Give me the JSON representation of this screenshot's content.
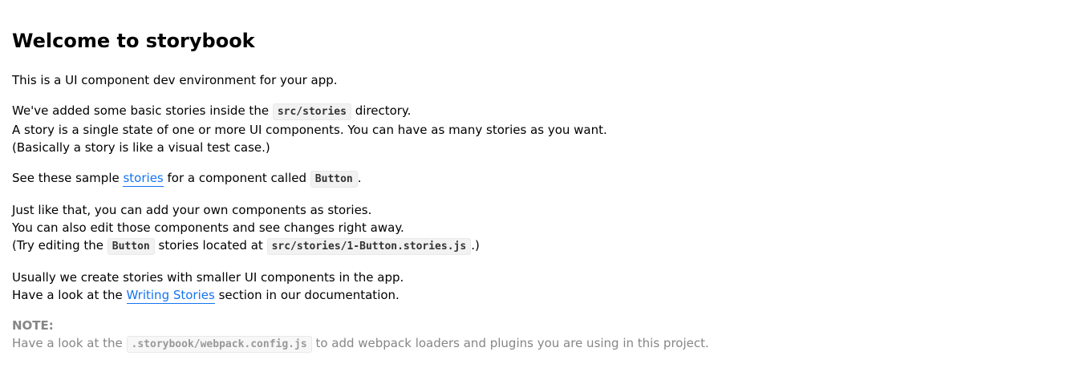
{
  "title": "Welcome to storybook",
  "p1": "This is a UI component dev environment for your app.",
  "p2": {
    "l1a": "We've added some basic stories inside the ",
    "l1code": "src/stories",
    "l1b": " directory.",
    "l2": "A story is a single state of one or more UI components. You can have as many stories as you want.",
    "l3": "(Basically a story is like a visual test case.)"
  },
  "p3": {
    "a": "See these sample ",
    "link": "stories",
    "b": " for a component called ",
    "code": "Button",
    "c": "."
  },
  "p4": {
    "l1": "Just like that, you can add your own components as stories.",
    "l2": "You can also edit those components and see changes right away.",
    "l3a": "(Try editing the ",
    "l3code1": "Button",
    "l3b": " stories located at ",
    "l3code2": "src/stories/1-Button.stories.js",
    "l3c": ".)"
  },
  "p5": {
    "l1": "Usually we create stories with smaller UI components in the app.",
    "l2a": "Have a look at the ",
    "link": "Writing Stories",
    "l2b": " section in our documentation."
  },
  "note": {
    "title": "NOTE:",
    "a": "Have a look at the ",
    "code": ".storybook/webpack.config.js",
    "b": " to add webpack loaders and plugins you are using in this project."
  },
  "colors": {
    "link": "#1474f3",
    "note": "#868686"
  }
}
